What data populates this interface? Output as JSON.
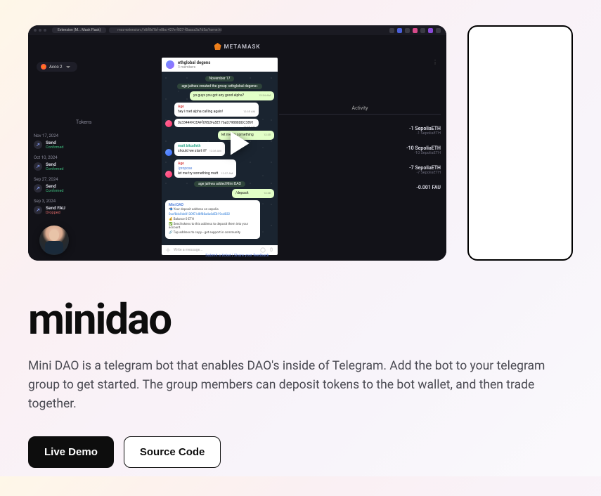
{
  "header": {
    "brand": "METAMASK"
  },
  "browser": {
    "tab": "Extension (M... Mask Flask)",
    "url": "moz-extension://d6f8d1bf-e8bc-427e-f827-f0aaca3a7d5a/home.html"
  },
  "account": {
    "label": "Acco 2"
  },
  "tokens_label": "Tokens",
  "activity_label": "Activity",
  "transactions": [
    {
      "date": "Nov 17, 2024",
      "name": "Send",
      "status": "Confirmed",
      "status_class": "ok"
    },
    {
      "date": "Oct 10, 2024",
      "name": "Send",
      "status": "Confirmed",
      "status_class": "ok"
    },
    {
      "date": "Sep 27, 2024",
      "name": "Send",
      "status": "Confirmed",
      "status_class": "ok"
    },
    {
      "date": "Sep 3, 2024",
      "name": "Send FAU",
      "status": "Dropped",
      "status_class": "drop"
    }
  ],
  "right_transactions": [
    {
      "amount": "-1 SepoliaETH",
      "sub": "-1 SepoliaETH"
    },
    {
      "amount": "-10 SepoliaETH",
      "sub": "-10 SepoliaETH"
    },
    {
      "amount": "-7 SepoliaETH",
      "sub": "-7 SepoliaETH"
    },
    {
      "amount": "-0.001 FAU",
      "sub": ""
    }
  ],
  "telegram": {
    "title": "ethglobal degens",
    "subtitle": "3 members",
    "date": "November 17",
    "messages": {
      "m0": "age jaihwa created the group «ethglobal degens»",
      "m1": "yo guys you got any good alpha?",
      "m2_sender": "Age",
      "m2": "hey i met alpha calling again!",
      "m3": "0x3344FFCEAFf0952Fa5E176aD79888DDC3891",
      "m4_sender": "Age",
      "m4": "let me try something",
      "m5_sender": "matt bitcalleth",
      "m5": "should we start it?",
      "m6_sender": "Age",
      "m6a": "/propose",
      "m6b": "let me try something matt",
      "m7": "age jaihwa added Mini DAO",
      "m8": "/deposit",
      "card_sender": "Mini DAO",
      "card_l1": "📬 Your deposit address on sepolia",
      "card_l2": "0xcf8dc0de8130fE1d8f88a4a6dE819cd832",
      "card_l3": "💰 Balance 0 ETH",
      "card_l4": "✅ Send tokens to this address to deposit them into your account.",
      "card_l5": "🔗 Tap address to copy • get support in community"
    },
    "input_placeholder": "Write a message..."
  },
  "footer_links": "Submit a ticket | Share your feedback",
  "project": {
    "title": "minidao",
    "description": "Mini DAO is a telegram bot that enables DAO's inside of Telegram. Add the bot to your telegram group to get started. The group members can deposit tokens to the bot wallet, and then trade together.",
    "live_demo": "Live Demo",
    "source_code": "Source Code"
  }
}
